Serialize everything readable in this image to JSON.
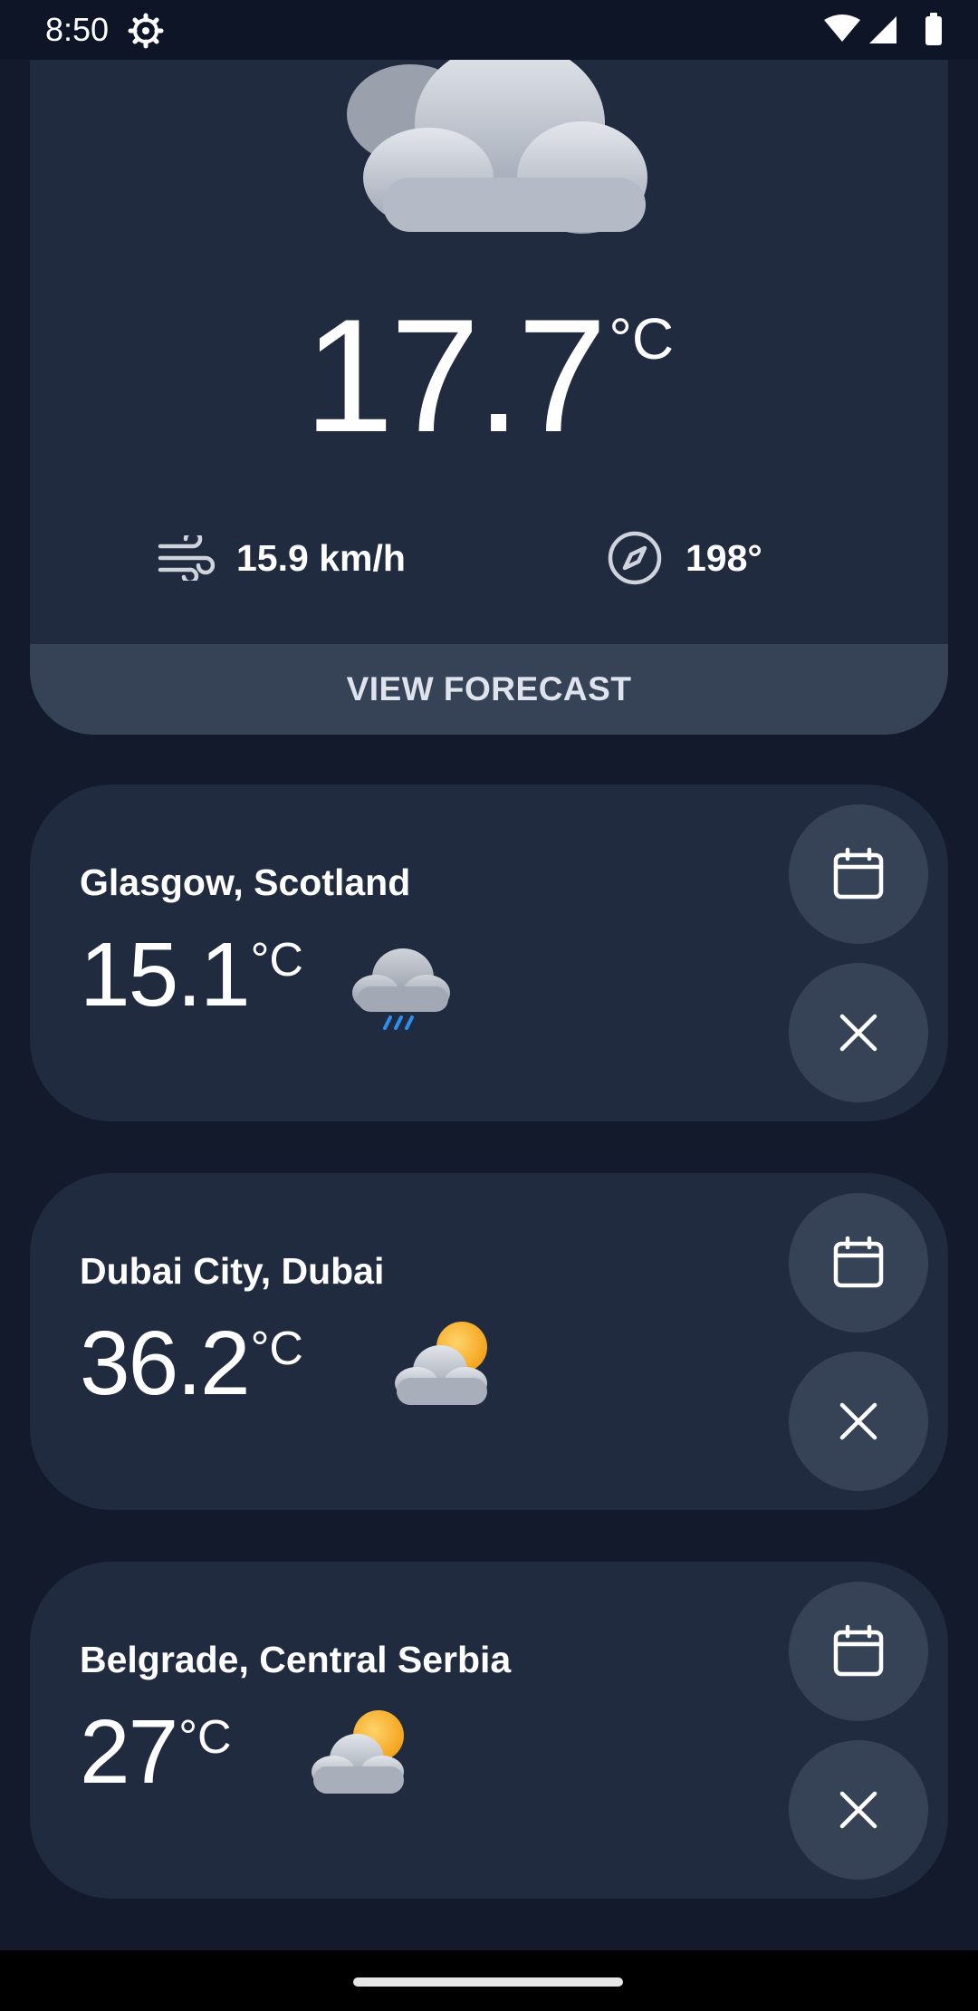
{
  "status_bar": {
    "time": "8:50",
    "icons": [
      "settings-gear-icon",
      "wifi-icon",
      "signal-icon",
      "battery-icon"
    ]
  },
  "current": {
    "icon": "cloudy-icon",
    "temperature": "17.7",
    "unit": "°C",
    "wind_speed": "15.9 km/h",
    "wind_direction": "198°",
    "forecast_button": "VIEW FORECAST"
  },
  "cities": [
    {
      "name": "Glasgow, Scotland",
      "temperature": "15.1",
      "unit": "°C",
      "icon": "rain-cloud-icon"
    },
    {
      "name": "Dubai City, Dubai",
      "temperature": "36.2",
      "unit": "°C",
      "icon": "partly-cloudy-icon"
    },
    {
      "name": "Belgrade, Central Serbia",
      "temperature": "27",
      "unit": "°C",
      "icon": "partly-cloudy-icon"
    }
  ],
  "colors": {
    "background": "#121a2c",
    "card": "#212b3f",
    "button": "#364357",
    "sun": "#f5a623",
    "rain": "#2b8ff0"
  }
}
